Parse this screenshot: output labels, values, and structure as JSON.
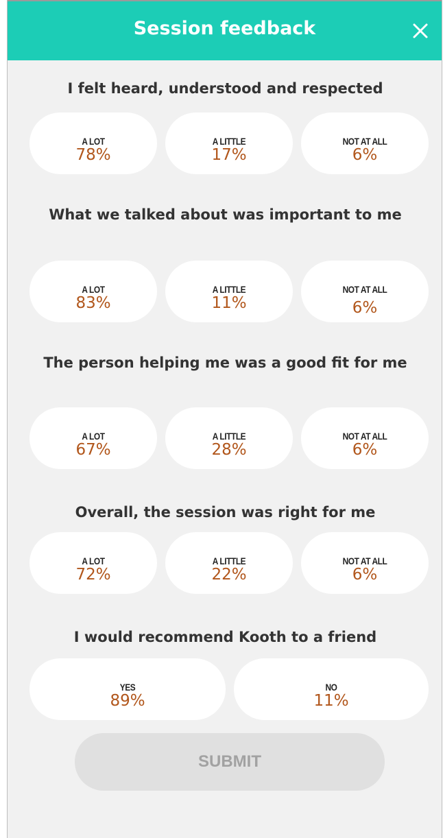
{
  "header": {
    "title": "Session feedback",
    "bg_color": "#1ccdb6",
    "close_icon": "close-icon"
  },
  "questions": [
    {
      "text": "I felt heard, understood and respected",
      "options": [
        {
          "label": "A LOT",
          "percent": "78%"
        },
        {
          "label": "A LITTLE",
          "percent": "17%"
        },
        {
          "label": "NOT AT ALL",
          "percent": "6%"
        }
      ]
    },
    {
      "text": "What we talked about was important to me",
      "options": [
        {
          "label": "A LOT",
          "percent": "83%"
        },
        {
          "label": "A LITTLE",
          "percent": "11%"
        },
        {
          "label": "NOT AT ALL",
          "percent": "6%"
        }
      ]
    },
    {
      "text": "The person helping me was a good fit for me",
      "options": [
        {
          "label": "A LOT",
          "percent": "67%"
        },
        {
          "label": "A LITTLE",
          "percent": "28%"
        },
        {
          "label": "NOT AT ALL",
          "percent": "6%"
        }
      ]
    },
    {
      "text": "Overall, the session was right for me",
      "options": [
        {
          "label": "A LOT",
          "percent": "72%"
        },
        {
          "label": "A LITTLE",
          "percent": "22%"
        },
        {
          "label": "NOT AT ALL",
          "percent": "6%"
        }
      ]
    },
    {
      "text": "I would recommend Kooth to a friend",
      "options": [
        {
          "label": "YES",
          "percent": "89%"
        },
        {
          "label": "NO",
          "percent": "11%"
        }
      ]
    }
  ],
  "submit_label": "SUBMIT",
  "colors": {
    "accent": "#1ccdb6",
    "percent_text": "#b1561b",
    "submit_disabled_bg": "#e0e0e0"
  }
}
